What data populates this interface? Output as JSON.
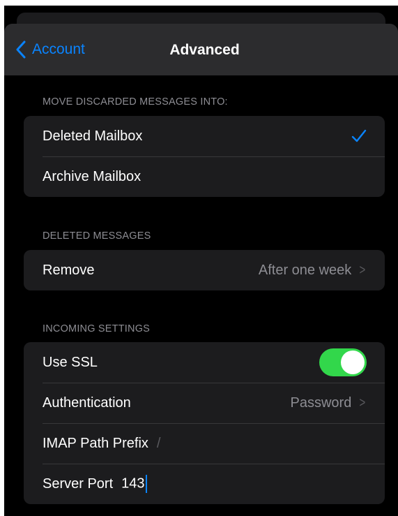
{
  "nav": {
    "back_label": "Account",
    "title": "Advanced"
  },
  "sections": {
    "move_discarded": {
      "header": "MOVE DISCARDED MESSAGES INTO:",
      "options": [
        {
          "label": "Deleted Mailbox",
          "selected": true
        },
        {
          "label": "Archive Mailbox",
          "selected": false
        }
      ]
    },
    "deleted_messages": {
      "header": "DELETED MESSAGES",
      "remove_label": "Remove",
      "remove_value": "After one week"
    },
    "incoming": {
      "header": "INCOMING SETTINGS",
      "ssl_label": "Use SSL",
      "ssl_on": true,
      "auth_label": "Authentication",
      "auth_value": "Password",
      "imap_label": "IMAP Path Prefix",
      "imap_placeholder": "/",
      "port_label": "Server Port",
      "port_value": "143"
    }
  },
  "icons": {
    "back": "chevron-left-icon",
    "check": "checkmark-icon",
    "disclosure": "chevron-right-icon"
  },
  "colors": {
    "accent": "#0a84ff",
    "toggle_on": "#32d74b",
    "background": "#000000",
    "group": "#1c1c1e",
    "secondary_text": "#8d8d93"
  }
}
